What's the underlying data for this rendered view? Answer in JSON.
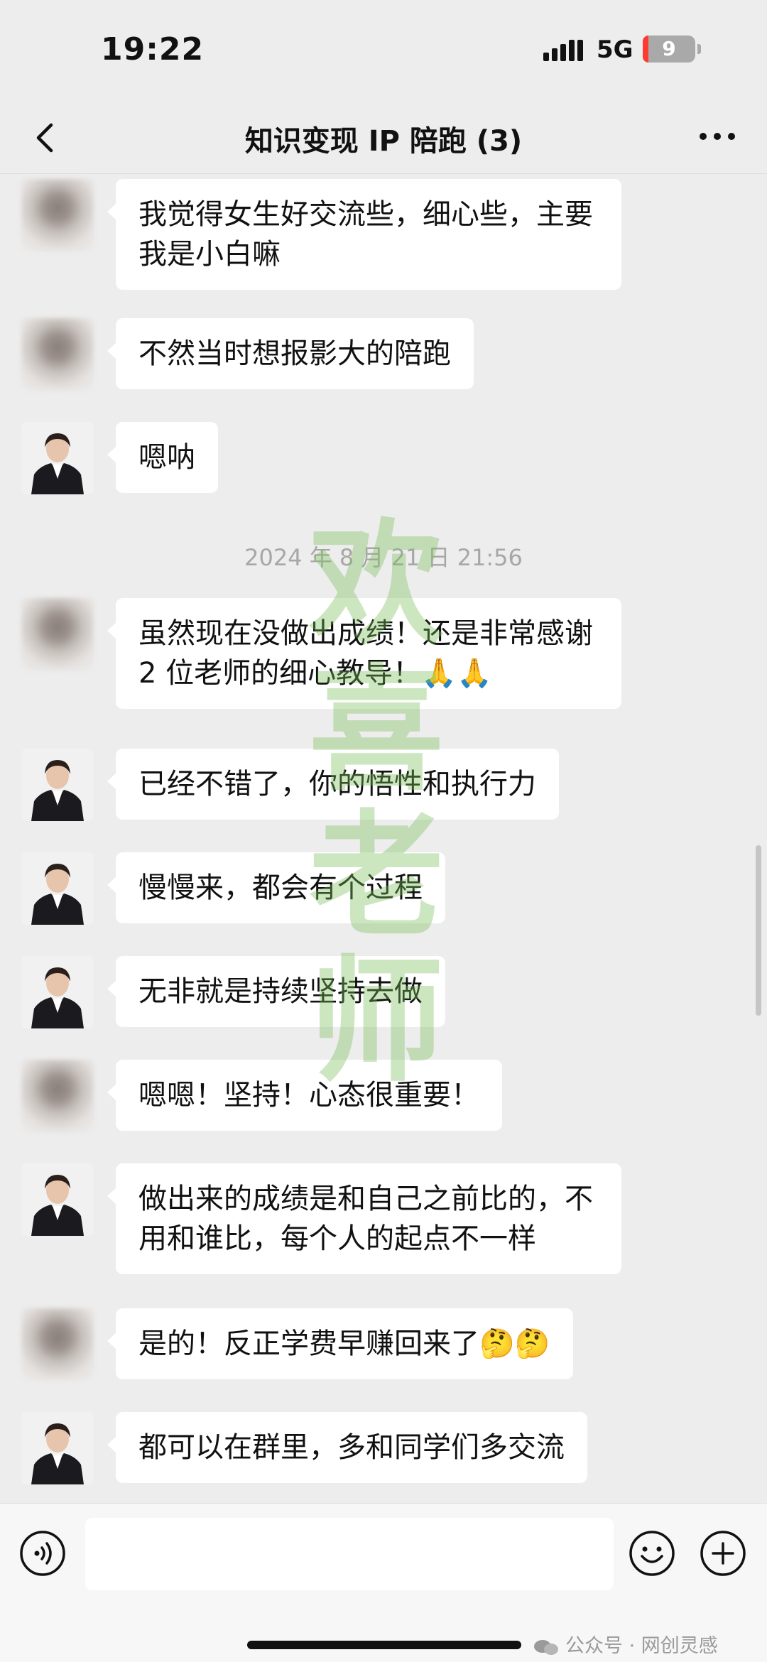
{
  "status_bar": {
    "time": "19:22",
    "network": "5G",
    "battery": "9"
  },
  "header": {
    "title": "知识变现 IP 陪跑 (3)"
  },
  "timestamp": "2024 年 8 月 21 日 21:56",
  "messages": [
    {
      "sender": "student",
      "text": "我觉得女生好交流些，细心些，主要我是小白嘛"
    },
    {
      "sender": "student",
      "text": "不然当时想报影大的陪跑"
    },
    {
      "sender": "teacher",
      "text": "嗯呐"
    },
    {
      "sender": "student",
      "text": "虽然现在没做出成绩！还是非常感谢 2 位老师的细心教导！🙏🙏"
    },
    {
      "sender": "teacher",
      "text": "已经不错了，你的悟性和执行力"
    },
    {
      "sender": "teacher",
      "text": "慢慢来，都会有个过程"
    },
    {
      "sender": "teacher",
      "text": "无非就是持续坚持去做"
    },
    {
      "sender": "student",
      "text": "嗯嗯！坚持！心态很重要！"
    },
    {
      "sender": "teacher",
      "text": "做出来的成绩是和自己之前比的，不用和谁比，每个人的起点不一样"
    },
    {
      "sender": "student",
      "text": "是的！反正学费早赚回来了🤔🤔"
    },
    {
      "sender": "teacher",
      "text": "都可以在群里，多和同学们多交流"
    }
  ],
  "watermark": [
    "欢",
    "喜",
    "老",
    "师"
  ],
  "footer": {
    "brand": "公众号 · 网创灵感"
  },
  "icons": {
    "back": "chevron-left-icon",
    "more": "more-dots-icon",
    "voice": "voice-icon",
    "emoji": "emoji-icon",
    "plus": "plus-icon"
  }
}
